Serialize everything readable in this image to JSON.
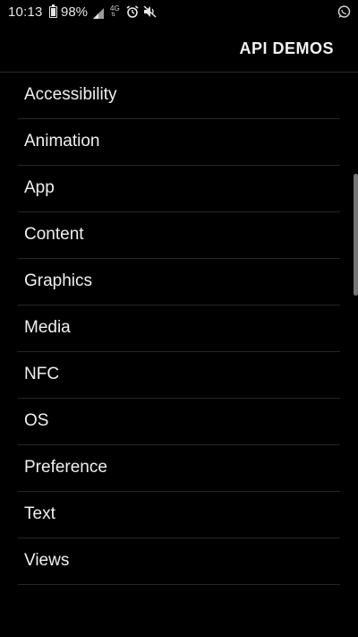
{
  "status_bar": {
    "time": "10:13",
    "battery_percent": "98%",
    "network_type": "4G",
    "icons": [
      "battery-icon",
      "signal-icon",
      "alarm-icon",
      "mute-icon",
      "whatsapp-icon"
    ]
  },
  "app_bar": {
    "title": "API DEMOS"
  },
  "list": {
    "items": [
      {
        "label": "Accessibility"
      },
      {
        "label": "Animation"
      },
      {
        "label": "App"
      },
      {
        "label": "Content"
      },
      {
        "label": "Graphics"
      },
      {
        "label": "Media"
      },
      {
        "label": "NFC"
      },
      {
        "label": "OS"
      },
      {
        "label": "Preference"
      },
      {
        "label": "Text"
      },
      {
        "label": "Views"
      }
    ]
  },
  "colors": {
    "background": "#000000",
    "text": "#f0f0f0",
    "divider": "#262626",
    "scrollbar": "#8a8a8a"
  }
}
